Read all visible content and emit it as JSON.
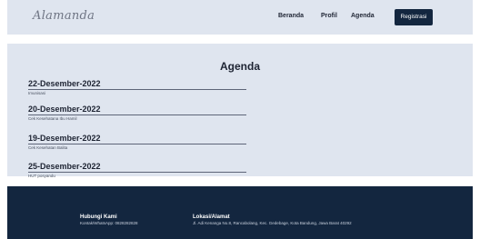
{
  "nav": {
    "logo": "Alamanda",
    "links": [
      "Beranda",
      "Profil",
      "Agenda"
    ],
    "cta": "Registrasi"
  },
  "agenda": {
    "title": "Agenda",
    "items": [
      {
        "date": "22-Desember-2022",
        "desc": "Imunisasi"
      },
      {
        "date": "20-Desember-2022",
        "desc": "Cek Kesehatana Ibu Hamil"
      },
      {
        "date": "19-Desember-2022",
        "desc": "Cek Kesehatan Balita"
      },
      {
        "date": "25-Desember-2022",
        "desc": "HUT posyandu"
      }
    ]
  },
  "footer": {
    "contact_title": "Hubungi Kami",
    "contact_text": "Kontak/WhatsApp: 0828282828",
    "location_title": "Lokasi/Alamat",
    "location_text": "Jl. Adi Kenanga No.8, Rancabolang, Kec. Gedebage, Kota Bandung, Jawa Barat 40292"
  },
  "colors": {
    "panel_bg": "#dfe5ef",
    "primary_dark": "#13263f"
  }
}
